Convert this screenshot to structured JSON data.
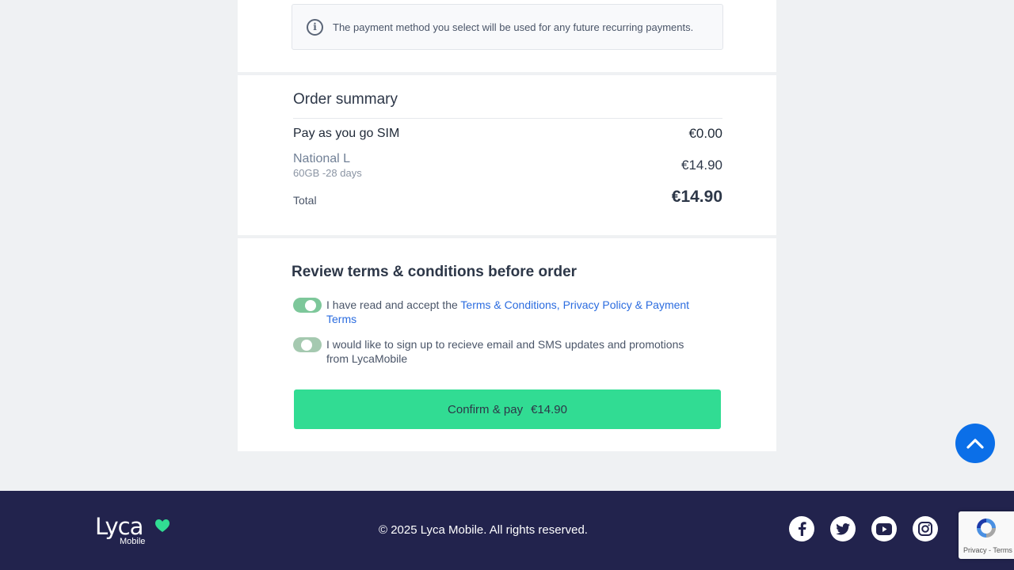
{
  "info": {
    "icon": "info-icon",
    "text": "The payment method you select will be used for any future recurring payments."
  },
  "summary": {
    "title": "Order summary",
    "sim_name": "Pay as you go SIM",
    "sim_price": "€0.00",
    "plan_name": "National L",
    "plan_details": "60GB -28 days",
    "plan_price": "€14.90",
    "total_label": "Total",
    "total_price": "€14.90"
  },
  "terms": {
    "title": "Review terms & conditions before order",
    "accept_prefix": "I have read and accept the ",
    "accept_link": "Terms & Conditions, Privacy Policy & Payment Terms",
    "accept_checked": true,
    "marketing_text": "I would like to sign up to recieve email and SMS updates and promotions from LycaMobile",
    "marketing_checked": true,
    "confirm_label": "Confirm & pay",
    "confirm_amount": "€14.90"
  },
  "scroll_top": {
    "icon": "chevron-up-icon"
  },
  "footer": {
    "logo_word": "Lyca",
    "logo_sub": "Mobile",
    "copyright": "© 2025 Lyca Mobile. All rights reserved.",
    "social": [
      "facebook-icon",
      "twitter-icon",
      "youtube-icon",
      "instagram-icon"
    ]
  },
  "recaptcha": {
    "text": "Privacy - Terms"
  },
  "colors": {
    "accent_green": "#31dc93",
    "link_blue": "#2b6cdf",
    "footer_bg": "#22234d",
    "scroll_button": "#0b6fe8"
  }
}
